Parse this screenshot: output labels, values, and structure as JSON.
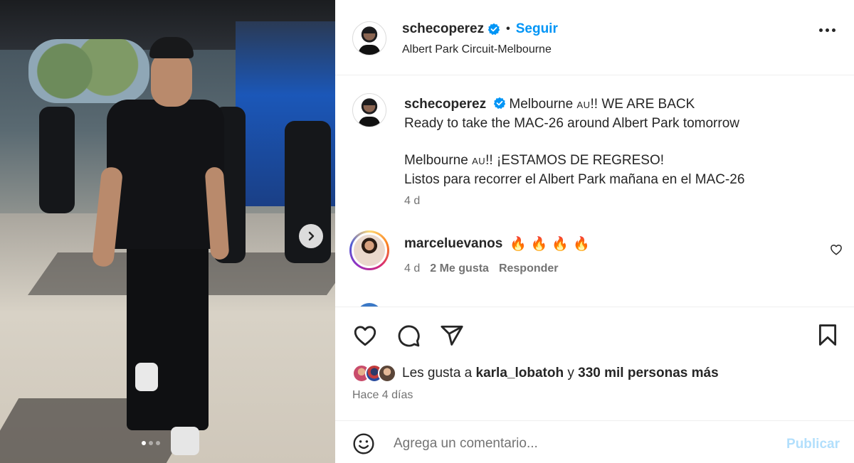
{
  "post": {
    "author": "schecoperez",
    "verified": true,
    "follow_label": "Seguir",
    "location": "Albert Park Circuit-Melbourne"
  },
  "caption": {
    "line1_a": "Melbourne ",
    "line1_au": "AU",
    "line1_b": "!! WE ARE BACK",
    "line2": "Ready to take the MAC-26 around Albert Park tomorrow",
    "line3_a": "Melbourne ",
    "line3_au": "AU",
    "line3_b": "!! ¡ESTAMOS DE REGRESO!",
    "line4": "Listos para recorrer el Albert Park mañana en el MAC-26",
    "time": "4 d"
  },
  "comment": {
    "user": "marceluevanos",
    "text": "🔥🔥🔥🔥",
    "time": "4 d",
    "likes": "2 Me gusta",
    "reply_label": "Responder"
  },
  "likes": {
    "prefix": "Les gusta a ",
    "user": "karla_lobatoh",
    "middle": " y ",
    "count": "330 mil personas más"
  },
  "posted_ago": "Hace 4 días",
  "composer": {
    "placeholder": "Agrega un comentario...",
    "publish_label": "Publicar"
  },
  "carousel": {
    "dots": 3,
    "active": 0
  },
  "icons": [
    "heart-icon",
    "comment-icon",
    "share-icon",
    "bookmark-icon",
    "emoji-icon",
    "more-icon",
    "chevron-right-icon",
    "verified-icon"
  ],
  "colors": {
    "link": "#0095f6",
    "verified": "#0095f6",
    "publish_disabled": "#b2dffc",
    "muted": "#737373"
  }
}
